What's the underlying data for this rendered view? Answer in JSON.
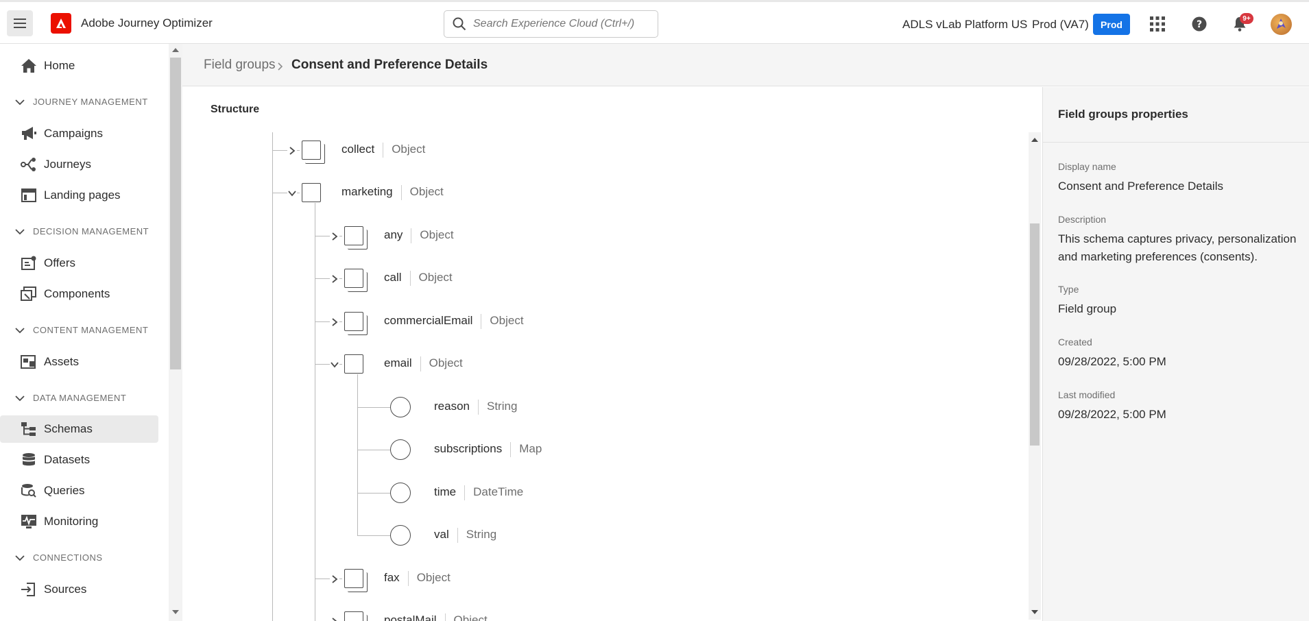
{
  "header": {
    "app_title": "Adobe Journey Optimizer",
    "search_placeholder": "Search Experience Cloud (Ctrl+/)",
    "org_name": "ADLS vLab Platform US",
    "sandbox_name": "Prod (VA7)",
    "sandbox_badge": "Prod",
    "notification_count": "9+",
    "brand_color": "#eb1000",
    "accent_color": "#1473e6"
  },
  "sidebar": {
    "home": "Home",
    "sections": {
      "journey_management": "JOURNEY MANAGEMENT",
      "decision_management": "DECISION MANAGEMENT",
      "content_management": "CONTENT MANAGEMENT",
      "data_management": "DATA MANAGEMENT",
      "connections": "CONNECTIONS"
    },
    "items": {
      "campaigns": "Campaigns",
      "journeys": "Journeys",
      "landing_pages": "Landing pages",
      "offers": "Offers",
      "components": "Components",
      "assets": "Assets",
      "schemas": "Schemas",
      "datasets": "Datasets",
      "queries": "Queries",
      "monitoring": "Monitoring",
      "sources": "Sources"
    }
  },
  "breadcrumb": {
    "parent": "Field groups",
    "current": "Consent and Preference Details"
  },
  "structure": {
    "title": "Structure",
    "nodes": [
      {
        "name": "collect",
        "type": "Object"
      },
      {
        "name": "marketing",
        "type": "Object"
      },
      {
        "name": "any",
        "type": "Object"
      },
      {
        "name": "call",
        "type": "Object"
      },
      {
        "name": "commercialEmail",
        "type": "Object"
      },
      {
        "name": "email",
        "type": "Object"
      },
      {
        "name": "reason",
        "type": "String"
      },
      {
        "name": "subscriptions",
        "type": "Map"
      },
      {
        "name": "time",
        "type": "DateTime"
      },
      {
        "name": "val",
        "type": "String"
      },
      {
        "name": "fax",
        "type": "Object"
      },
      {
        "name": "postalMail",
        "type": "Object"
      }
    ]
  },
  "properties": {
    "title": "Field groups properties",
    "display_name_label": "Display name",
    "display_name": "Consent and Preference Details",
    "description_label": "Description",
    "description": "This schema captures privacy, personalization and marketing preferences (consents).",
    "type_label": "Type",
    "type": "Field group",
    "created_label": "Created",
    "created": "09/28/2022, 5:00 PM",
    "modified_label": "Last modified",
    "modified": "09/28/2022, 5:00 PM"
  }
}
